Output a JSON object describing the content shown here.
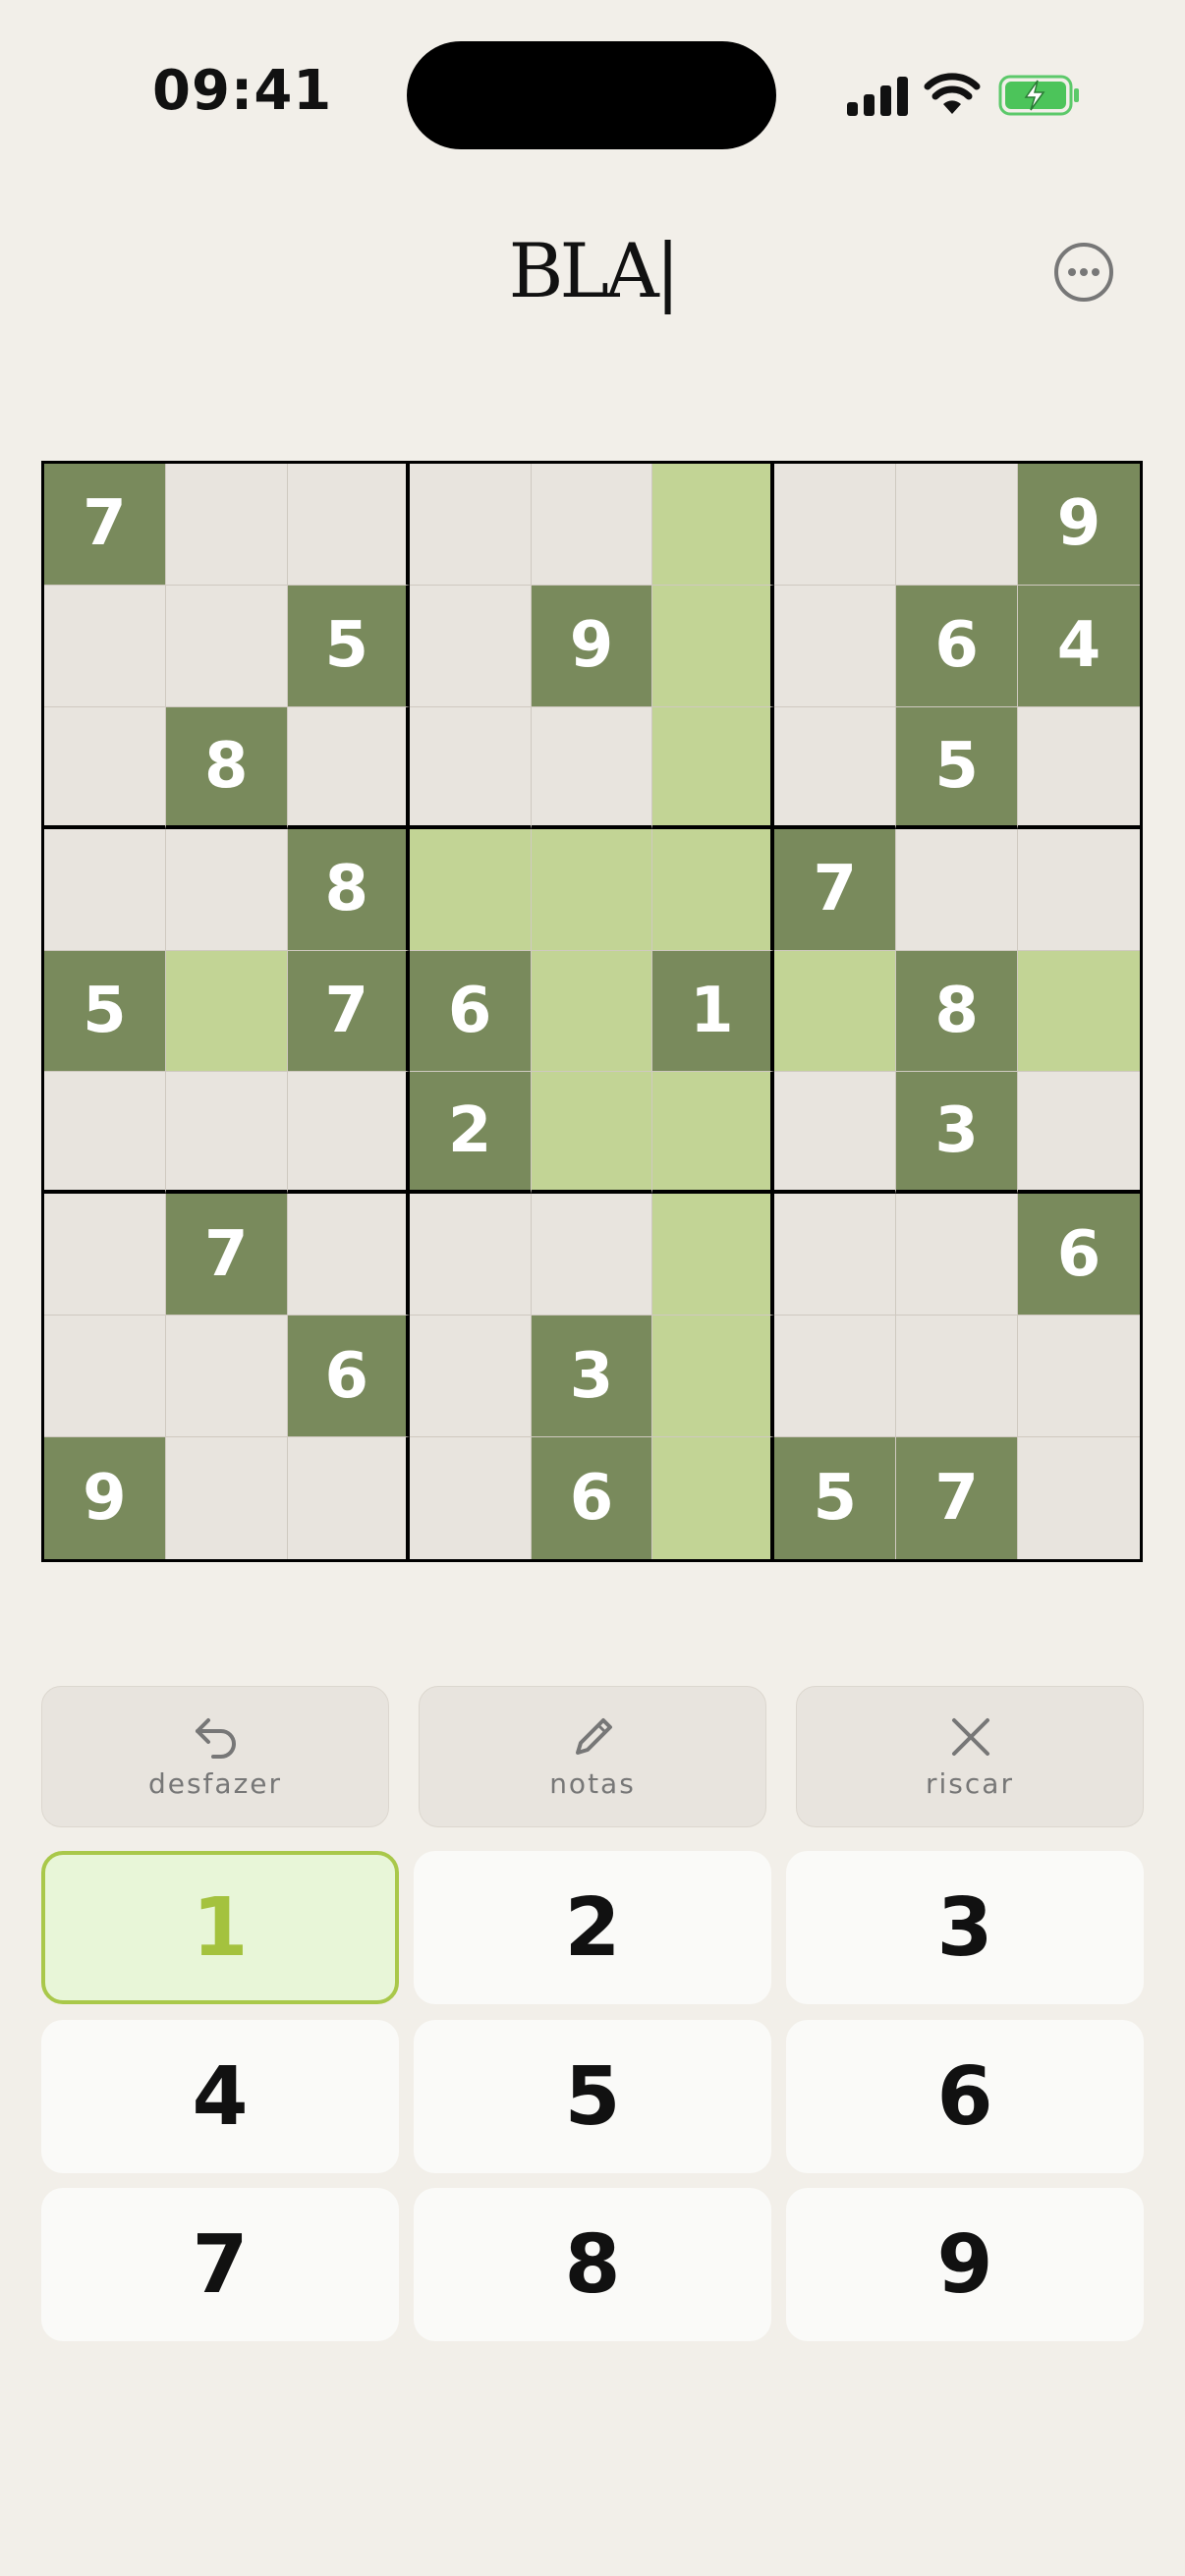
{
  "status": {
    "time": "09:41"
  },
  "header": {
    "logo": "BLA|"
  },
  "icons": {
    "more": "more-horizontal-icon",
    "undo": "undo-icon",
    "pencil": "pencil-icon",
    "close": "x-icon",
    "signal": "signal-icon",
    "wifi": "wifi-icon",
    "battery": "battery-charging-icon"
  },
  "colors": {
    "given": "#798a5c",
    "highlight": "#c2d495",
    "empty": "#e8e4de",
    "selected_key_fill": "#e8f6d8",
    "selected_key_border": "#a9c84a"
  },
  "board": [
    [
      "7",
      "",
      "",
      "",
      "",
      "",
      "",
      "",
      "9"
    ],
    [
      "",
      "",
      "5",
      "",
      "9",
      "",
      "",
      "6",
      "4"
    ],
    [
      "",
      "8",
      "",
      "",
      "",
      "",
      "",
      "5",
      ""
    ],
    [
      "",
      "",
      "8",
      "",
      "",
      "",
      "7",
      "",
      ""
    ],
    [
      "5",
      "",
      "7",
      "6",
      "",
      "1",
      "",
      "8",
      ""
    ],
    [
      "",
      "",
      "",
      "2",
      "",
      "",
      "",
      "3",
      ""
    ],
    [
      "",
      "7",
      "",
      "",
      "",
      "",
      "",
      "",
      "6"
    ],
    [
      "",
      "",
      "6",
      "",
      "3",
      "",
      "",
      "",
      ""
    ],
    [
      "9",
      "",
      "",
      "",
      "6",
      "",
      "5",
      "7",
      ""
    ]
  ],
  "highlighted": [
    [
      0,
      5
    ],
    [
      1,
      5
    ],
    [
      2,
      5
    ],
    [
      3,
      3
    ],
    [
      3,
      4
    ],
    [
      3,
      5
    ],
    [
      4,
      1
    ],
    [
      4,
      4
    ],
    [
      4,
      6
    ],
    [
      4,
      8
    ],
    [
      5,
      4
    ],
    [
      5,
      5
    ],
    [
      6,
      5
    ],
    [
      7,
      5
    ],
    [
      8,
      5
    ]
  ],
  "tools": {
    "undo": "desfazer",
    "notes": "notas",
    "erase": "riscar"
  },
  "keypad": {
    "keys": [
      "1",
      "2",
      "3",
      "4",
      "5",
      "6",
      "7",
      "8",
      "9"
    ],
    "selected": "1"
  }
}
